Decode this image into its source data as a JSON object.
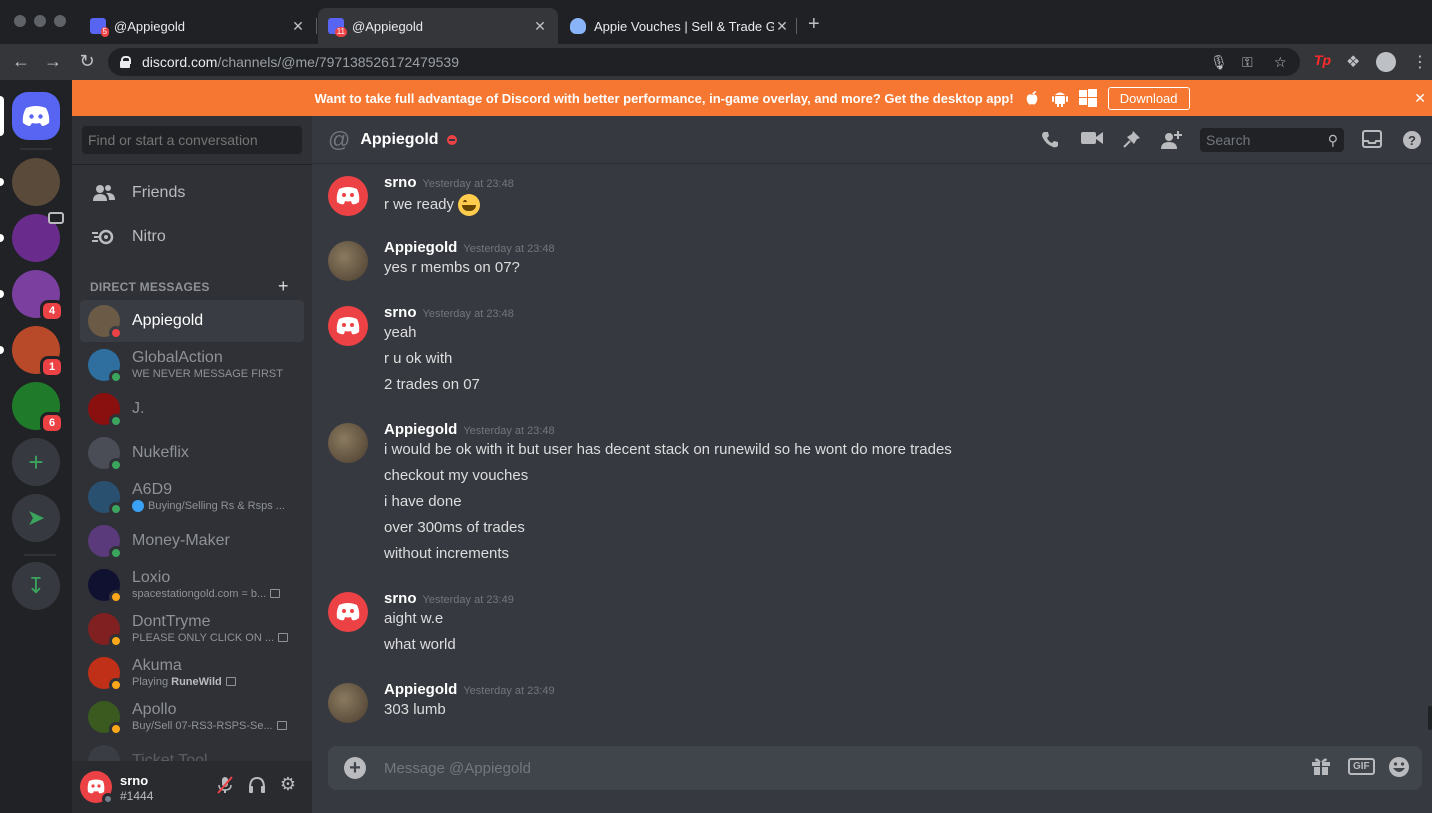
{
  "browser": {
    "tabs": [
      {
        "title": "@Appiegold",
        "badge": "5",
        "active": false
      },
      {
        "title": "@Appiegold",
        "badge": "11",
        "active": true
      },
      {
        "title": "Appie Vouches | Sell & Trade G",
        "badge": "",
        "active": false
      }
    ],
    "tab_close": "✕",
    "new_tab": "+",
    "url_host": "discord.com",
    "url_path": "/channels/@me/797138526172479539",
    "ext_tp": "Tp"
  },
  "notice": {
    "text": "Want to take full advantage of Discord with better performance, in-game overlay, and more? Get the desktop app!",
    "download_label": "Download",
    "close": "✕"
  },
  "guilds": [
    {
      "badge": "",
      "color": "#5a4a3a"
    },
    {
      "badge": "",
      "color": "#6a2c8c"
    },
    {
      "badge": "4",
      "color": "#7b3fa0"
    },
    {
      "badge": "1",
      "color": "#b84a2a"
    },
    {
      "badge": "6",
      "color": "#1f7a2a"
    }
  ],
  "sidebar": {
    "search_placeholder": "Find or start a conversation",
    "friends_label": "Friends",
    "nitro_label": "Nitro",
    "dm_header": "DIRECT MESSAGES",
    "dm_add": "+",
    "dms": [
      {
        "name": "Appiegold",
        "sub": "",
        "status": "dnd",
        "color": "#6b5a45"
      },
      {
        "name": "GlobalAction",
        "sub": "WE NEVER MESSAGE FIRST",
        "status": "online",
        "color": "#2e6fa0"
      },
      {
        "name": "J.",
        "sub": "",
        "status": "online",
        "color": "#8a1010"
      },
      {
        "name": "Nukeflix",
        "sub": "",
        "status": "online",
        "color": "#4a4d55"
      },
      {
        "name": "A6D9",
        "sub": "Buying/Selling Rs & Rsps ...",
        "status": "online",
        "color": "#2a5070"
      },
      {
        "name": "Money-Maker",
        "sub": "",
        "status": "online",
        "color": "#5a3a7a"
      },
      {
        "name": "Loxio",
        "sub": "spacestationgold.com = b...",
        "status": "idle",
        "color": "#101030"
      },
      {
        "name": "DontTryme",
        "sub": "PLEASE ONLY CLICK ON ...",
        "status": "idle",
        "color": "#802020"
      },
      {
        "name": "Akuma",
        "sub_prefix": "Playing ",
        "sub_bold": "RuneWild",
        "status": "idle",
        "color": "#c03018"
      },
      {
        "name": "Apollo",
        "sub": "Buy/Sell 07-RS3-RSPS-Se...",
        "status": "idle",
        "color": "#3a5a20"
      },
      {
        "name": "Ticket Tool",
        "sub": "",
        "status": "",
        "color": "#4a4d55"
      }
    ],
    "user": {
      "name": "srno",
      "tag": "#1444"
    }
  },
  "chat": {
    "header_at": "@",
    "header_name": "Appiegold",
    "search_placeholder": "Search",
    "composer_placeholder": "Message @Appiegold",
    "gif_label": "GIF",
    "groups": [
      {
        "author": "srno",
        "time": "Yesterday at 23:48",
        "avatar": "discord",
        "lines": [
          "r we ready"
        ]
      },
      {
        "author": "Appiegold",
        "time": "Yesterday at 23:48",
        "avatar": "photo",
        "lines": [
          "yes r membs on 07?"
        ]
      },
      {
        "author": "srno",
        "time": "Yesterday at 23:48",
        "avatar": "discord",
        "lines": [
          "yeah",
          "r u ok with",
          "2 trades on 07"
        ]
      },
      {
        "author": "Appiegold",
        "time": "Yesterday at 23:48",
        "avatar": "photo",
        "lines": [
          "i would be ok with it but user has decent stack on runewild so he wont do more trades",
          "checkout my vouches",
          "i have done",
          "over 300ms of trades",
          "without increments"
        ]
      },
      {
        "author": "srno",
        "time": "Yesterday at 23:49",
        "avatar": "discord",
        "lines": [
          "aight w.e",
          "what world"
        ]
      },
      {
        "author": "Appiegold",
        "time": "Yesterday at 23:49",
        "avatar": "photo",
        "lines": [
          "303 lumb"
        ]
      }
    ]
  },
  "colors": {
    "blurple": "#5865f2",
    "red": "#ed4245",
    "green": "#3ba55d",
    "orange": "#f57731",
    "idle": "#faa81a"
  },
  "icons": [
    "back-arrow-icon",
    "forward-arrow-icon",
    "reload-icon",
    "lock-icon",
    "mic-icon",
    "key-icon",
    "star-icon",
    "puzzle-icon",
    "profile-icon",
    "menu-dots-icon",
    "friends-icon",
    "nitro-icon",
    "mute-mic-icon",
    "headphones-icon",
    "settings-gear-icon",
    "call-icon",
    "video-icon",
    "pin-icon",
    "add-friend-icon",
    "inbox-icon",
    "help-icon",
    "gift-icon",
    "emoji-icon"
  ]
}
